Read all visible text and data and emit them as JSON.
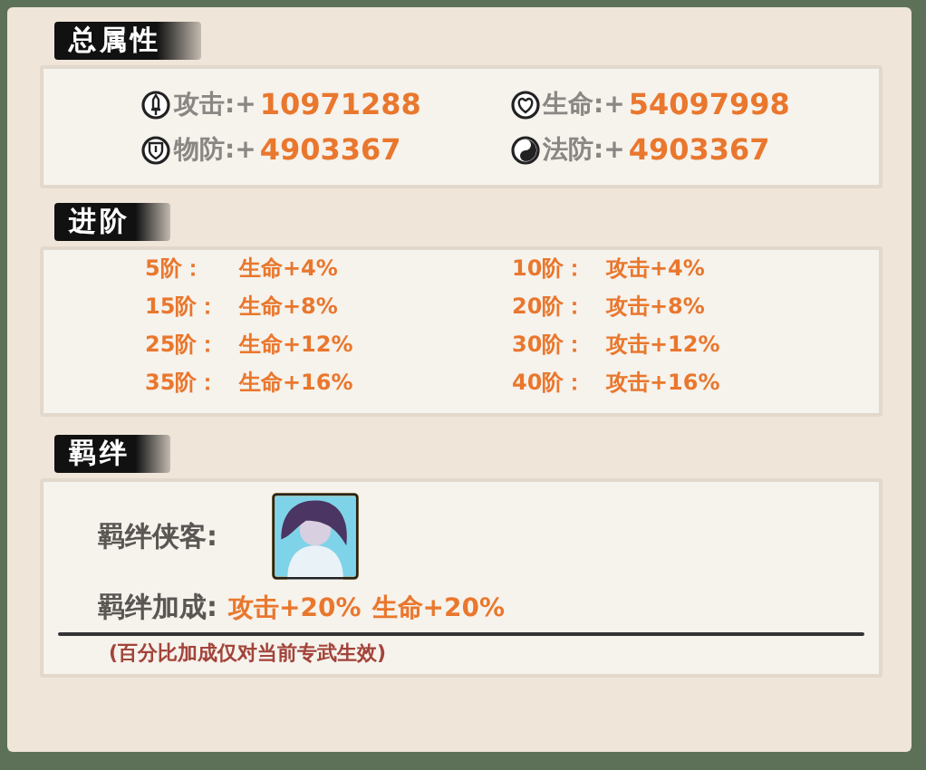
{
  "total_attributes": {
    "title": "总属性",
    "stats": [
      {
        "kind": "attack",
        "label": "攻击:+",
        "value": "10971288"
      },
      {
        "kind": "health",
        "label": "生命:+",
        "value": "54097998"
      },
      {
        "kind": "physical_defense",
        "label": "物防:+",
        "value": "4903367"
      },
      {
        "kind": "magic_defense",
        "label": "法防:+",
        "value": "4903367"
      }
    ]
  },
  "advancement": {
    "title": "进阶",
    "tiers": [
      {
        "tier": "5阶：",
        "bonus": "生命+4%"
      },
      {
        "tier": "10阶：",
        "bonus": "攻击+4%"
      },
      {
        "tier": "15阶：",
        "bonus": "生命+8%"
      },
      {
        "tier": "20阶：",
        "bonus": "攻击+8%"
      },
      {
        "tier": "25阶：",
        "bonus": "生命+12%"
      },
      {
        "tier": "30阶：",
        "bonus": "攻击+12%"
      },
      {
        "tier": "35阶：",
        "bonus": "生命+16%"
      },
      {
        "tier": "40阶：",
        "bonus": "攻击+16%"
      }
    ]
  },
  "bond": {
    "title": "羁绊",
    "hero_label": "羁绊侠客:",
    "bonus_label": "羁绊加成:",
    "bonuses": [
      "攻击+20%",
      "生命+20%"
    ],
    "note": "(百分比加成仅对当前专武生效)"
  }
}
